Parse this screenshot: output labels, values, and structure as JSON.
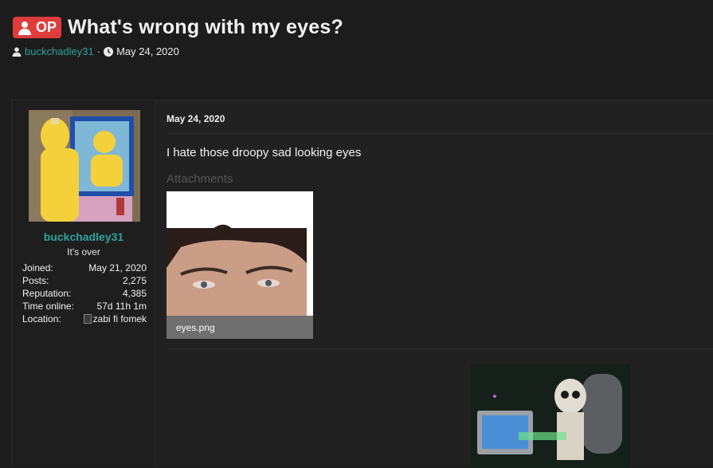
{
  "thread": {
    "badge_label": "OP",
    "title": "What's wrong with my eyes?",
    "author": "buckchadley31",
    "separator": "·",
    "date": "May 24, 2020"
  },
  "user": {
    "name": "buckchadley31",
    "title": "It's over",
    "stats": [
      {
        "label": "Joined:",
        "value": "May 21, 2020"
      },
      {
        "label": "Posts:",
        "value": "2,275"
      },
      {
        "label": "Reputation:",
        "value": "4,385"
      },
      {
        "label": "Time online:",
        "value": "57d 11h 1m"
      },
      {
        "label": "Location:",
        "value": "zabi fi fomek"
      }
    ]
  },
  "post": {
    "date": "May 24, 2020",
    "text": "I hate those droopy sad looking eyes",
    "attachments_label": "Attachments",
    "attachment_filename": "eyes.png"
  },
  "colors": {
    "accent": "#2fa39a",
    "op_badge": "#e03c3c",
    "background": "#1c1c1c"
  }
}
